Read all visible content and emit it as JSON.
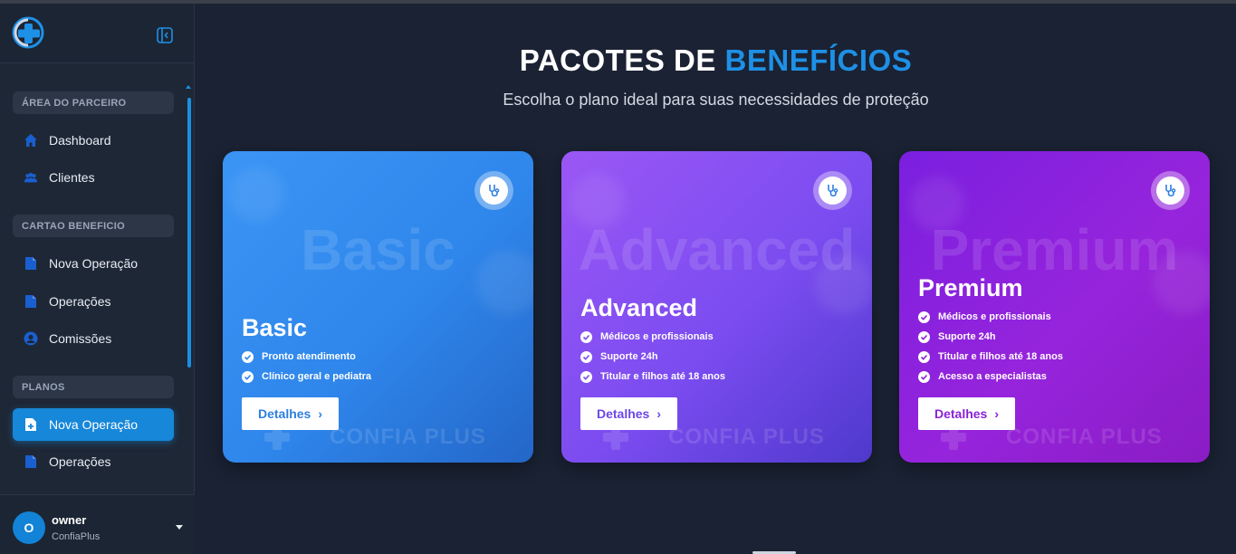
{
  "sidebar": {
    "sections": [
      {
        "label": "ÁREA DO PARCEIRO"
      },
      {
        "label": "CARTAO BENEFICIO"
      },
      {
        "label": "PLANOS"
      }
    ],
    "items": [
      {
        "label": "Dashboard",
        "icon": "home-icon"
      },
      {
        "label": "Clientes",
        "icon": "users-icon"
      },
      {
        "label": "Nova Operação",
        "icon": "document-icon"
      },
      {
        "label": "Operações",
        "icon": "document-icon"
      },
      {
        "label": "Comissões",
        "icon": "user-circle-icon"
      },
      {
        "label": "Nova Operação",
        "icon": "document-add-icon",
        "active": true
      },
      {
        "label": "Operações",
        "icon": "document-icon"
      }
    ],
    "user": {
      "initial": "O",
      "name": "owner",
      "org": "ConfiaPlus"
    }
  },
  "main": {
    "title_part1": "PACOTES DE",
    "title_part2": "BENEFÍCIOS",
    "subtitle": "Escolha o plano ideal para suas necessidades de proteção",
    "cards": [
      {
        "name": "Basic",
        "watermark_word": "Basic",
        "features": [
          "Pronto atendimento",
          "Clínico geral e pediatra"
        ],
        "button": "Detalhes",
        "brand": "CONFIA PLUS"
      },
      {
        "name": "Advanced",
        "watermark_word": "Advanced",
        "features": [
          "Médicos e profissionais",
          "Suporte 24h",
          "Titular e filhos até 18 anos"
        ],
        "button": "Detalhes",
        "brand": "CONFIA PLUS"
      },
      {
        "name": "Premium",
        "watermark_word": "Premium",
        "features": [
          "Médicos e profissionais",
          "Suporte 24h",
          "Titular e filhos até 18 anos",
          "Acesso a especialistas"
        ],
        "button": "Detalhes",
        "brand": "CONFIA PLUS"
      }
    ]
  },
  "colors": {
    "accent": "#1e90e6",
    "sidebar_bg": "#1e2736",
    "page_bg": "#1a2233",
    "basic": "#3b95f5",
    "advanced": "#8a52f3",
    "premium": "#8a22d8"
  }
}
